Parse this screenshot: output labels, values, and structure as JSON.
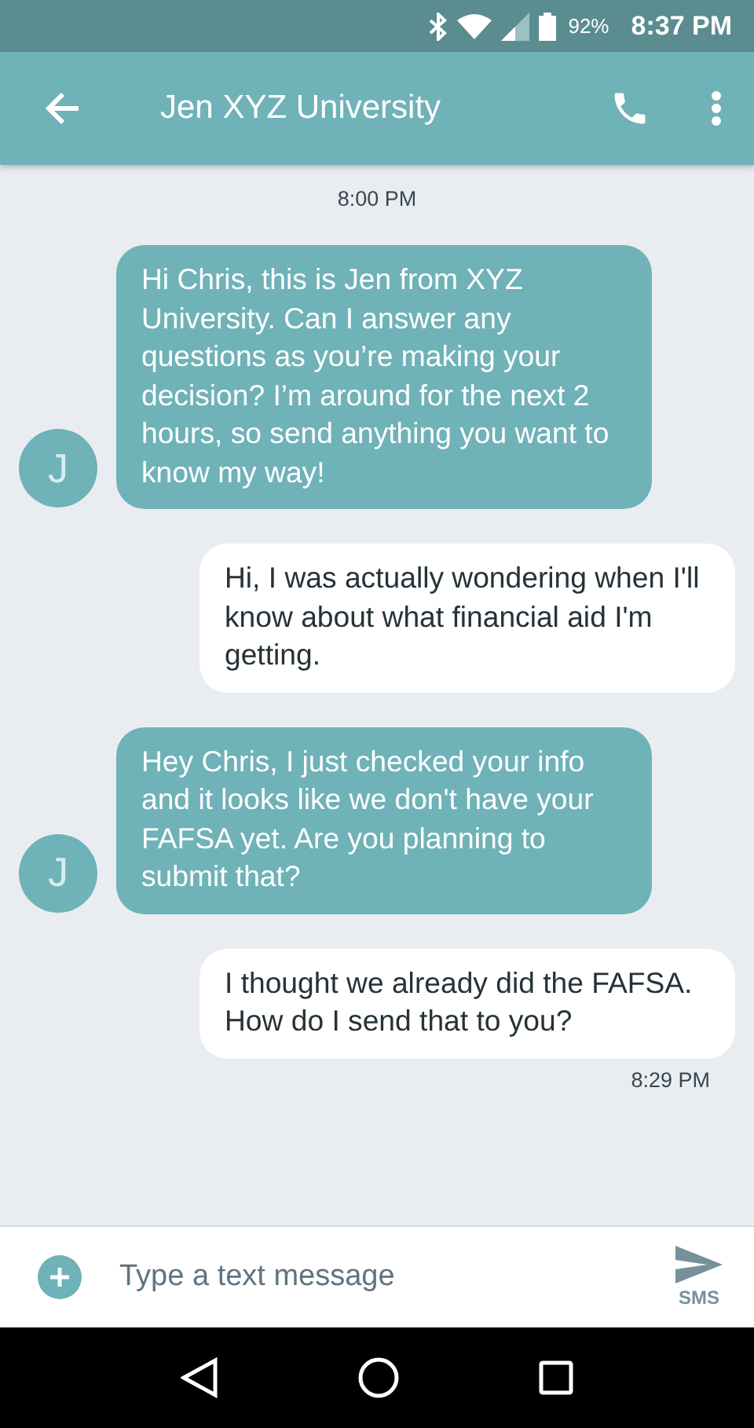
{
  "status_bar": {
    "battery": "92%",
    "time": "8:37 PM"
  },
  "header": {
    "title": "Jen XYZ University"
  },
  "messages": [
    {
      "kind": "timestamp",
      "text": "8:00 PM"
    },
    {
      "kind": "incoming",
      "avatar": "J",
      "text": "Hi Chris, this is Jen from XYZ University. Can I answer any questions as you’re making your decision? I’m around for the next 2 hours, so send anything you want to know my way!"
    },
    {
      "kind": "outgoing",
      "text": "Hi, I was actually wondering when I'll know about what financial aid I'm getting."
    },
    {
      "kind": "incoming",
      "avatar": "J",
      "text": "Hey Chris, I just checked your info and it looks like we don't have your FAFSA yet. Are you planning to submit that?"
    },
    {
      "kind": "outgoing",
      "text": "I thought we already did the FAFSA. How do I send that to you?"
    },
    {
      "kind": "timestamp_right",
      "text": "8:29 PM"
    }
  ],
  "composer": {
    "placeholder": "Type a text message",
    "send_label": "SMS"
  }
}
